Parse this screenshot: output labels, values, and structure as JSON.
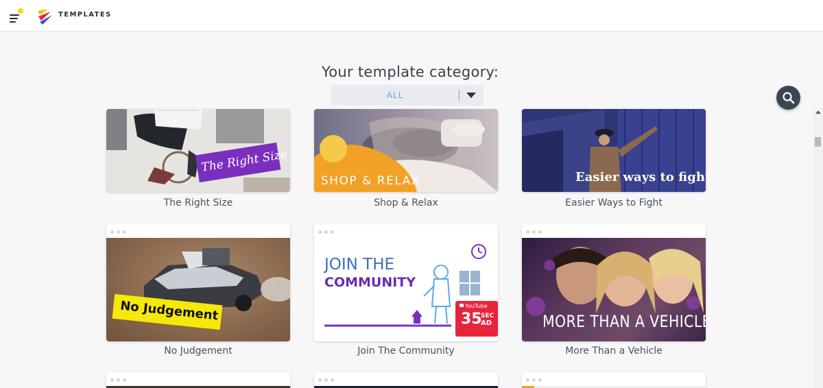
{
  "app": {
    "brand": "TEMPLATES"
  },
  "heading": "Your template category:",
  "category": {
    "selected": "ALL"
  },
  "cards": [
    {
      "caption": "The Right Size",
      "overlay": "The Right Size"
    },
    {
      "caption": "Shop & Relax",
      "overlay": "SHOP & RELAX"
    },
    {
      "caption": "Easier Ways to Fight",
      "overlay": "Easier ways to fight"
    },
    {
      "caption": "No Judgement",
      "overlay": "No Judgement"
    },
    {
      "caption": "Join The Community",
      "overlay_line1": "JOIN THE",
      "overlay_line2": "COMMUNITY",
      "badge_brand": "YouTube",
      "badge_num": "35",
      "badge_sec": "SEC",
      "badge_ad": "AD"
    },
    {
      "caption": "More Than a Vehicle",
      "overlay": "MORE THAN A VEHICLE"
    }
  ],
  "colors": {
    "accent": "#5aa7e8",
    "purple": "#7a2fbf",
    "yellow": "#f5e90a",
    "red": "#e8243c"
  }
}
